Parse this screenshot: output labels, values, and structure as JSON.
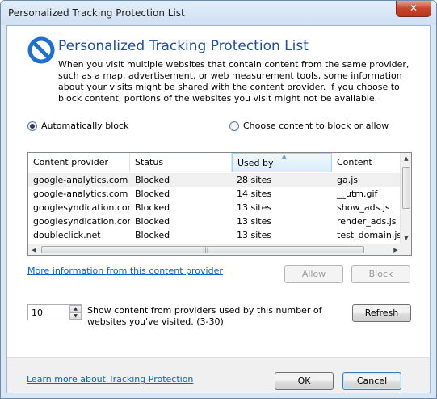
{
  "window": {
    "title": "Personalized Tracking Protection List",
    "close_glyph": "✕"
  },
  "header": {
    "title": "Personalized Tracking Protection List",
    "description": "When you visit multiple websites that contain content from the same provider, such as a map, advertisement, or web measurement tools, some information about your visits might be shared with the content provider.  If you choose to block content, portions of the websites you visit might not be available.",
    "icon": "block-icon"
  },
  "options": {
    "auto_block_label": "Automatically block",
    "choose_label": "Choose content to block or allow",
    "selected": "auto"
  },
  "table": {
    "columns": [
      "Content provider",
      "Status",
      "Used by",
      "Content"
    ],
    "sorted_column": "Used by",
    "rows": [
      {
        "provider": "google-analytics.com",
        "status": "Blocked",
        "used_by": "28 sites",
        "content": "ga.js"
      },
      {
        "provider": "google-analytics.com",
        "status": "Blocked",
        "used_by": "14 sites",
        "content": "__utm.gif"
      },
      {
        "provider": "googlesyndication.com",
        "status": "Blocked",
        "used_by": "13 sites",
        "content": "show_ads.js"
      },
      {
        "provider": "googlesyndication.com",
        "status": "Blocked",
        "used_by": "13 sites",
        "content": "render_ads.js"
      },
      {
        "provider": "doubleclick.net",
        "status": "Blocked",
        "used_by": "13 sites",
        "content": "test_domain.js"
      }
    ]
  },
  "actions": {
    "more_info_link": "More information from this content provider",
    "allow_label": "Allow",
    "block_label": "Block"
  },
  "threshold": {
    "value": "10",
    "description": "Show content from providers used by this number of websites you've visited. (3-30)",
    "refresh_label": "Refresh"
  },
  "footer": {
    "learn_more_link": "Learn more about Tracking Protection",
    "ok_label": "OK",
    "cancel_label": "Cancel"
  },
  "colors": {
    "heading": "#1f4e9d",
    "link": "#0066cc",
    "icon_blue": "#1e6fd0"
  }
}
